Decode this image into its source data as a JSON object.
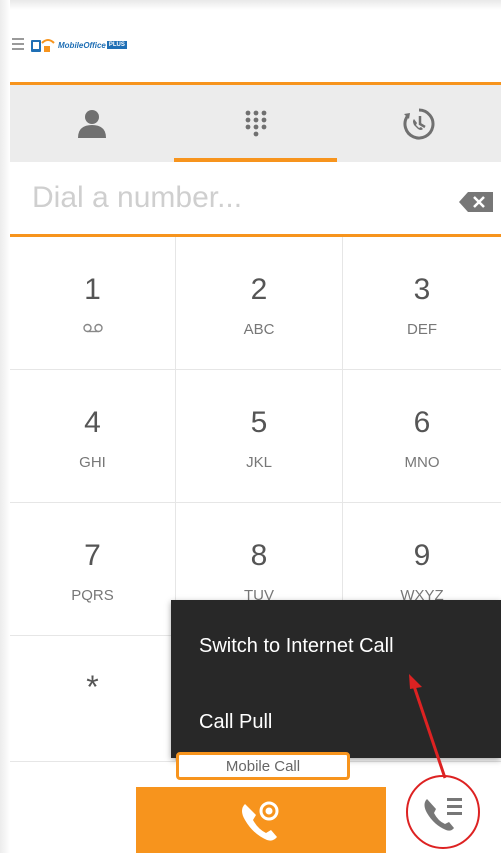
{
  "header": {
    "logo_text": "MobileOffice",
    "logo_plus": "PLUS"
  },
  "tabs": [
    {
      "icon": "contact-icon"
    },
    {
      "icon": "dialpad-icon",
      "active": true
    },
    {
      "icon": "history-icon"
    }
  ],
  "dialer": {
    "placeholder": "Dial a number...",
    "value": ""
  },
  "keypad": [
    {
      "digit": "1",
      "letters": "",
      "icon": "voicemail-icon"
    },
    {
      "digit": "2",
      "letters": "ABC"
    },
    {
      "digit": "3",
      "letters": "DEF"
    },
    {
      "digit": "4",
      "letters": "GHI"
    },
    {
      "digit": "5",
      "letters": "JKL"
    },
    {
      "digit": "6",
      "letters": "MNO"
    },
    {
      "digit": "7",
      "letters": "PQRS"
    },
    {
      "digit": "8",
      "letters": "TUV"
    },
    {
      "digit": "9",
      "letters": "WXYZ"
    },
    {
      "digit": "*",
      "letters": ""
    }
  ],
  "popup_menu": {
    "items": [
      "Switch to Internet Call",
      "Call Pull"
    ]
  },
  "call_type_label": "Mobile Call",
  "colors": {
    "accent": "#f7941d",
    "menu_bg": "#282828",
    "annotation": "#dd2222"
  }
}
